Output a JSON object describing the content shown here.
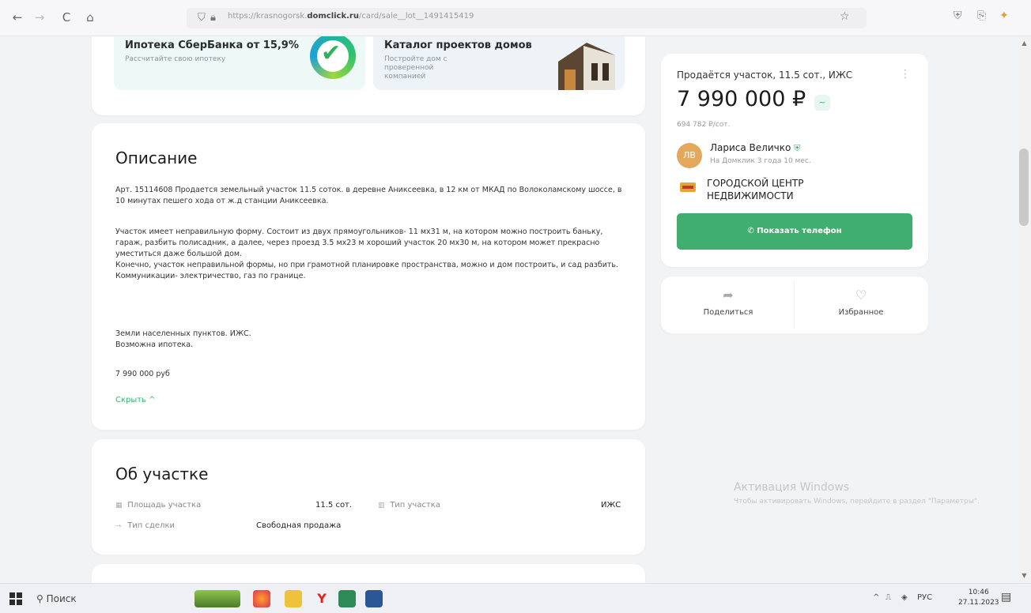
{
  "browser": {
    "back": "←",
    "forward": "→",
    "reload": "C",
    "home": "⌂",
    "url_prefix": "https://krasnogorsk.",
    "url_domain": "domclick.ru",
    "url_suffix": "/card/sale__lot__1491415419",
    "star": "☆"
  },
  "promos": [
    {
      "title": "Ипотека СберБанка от 15,9%",
      "subtitle": "Рассчитайте свою ипотеку"
    },
    {
      "title": "Каталог проектов домов",
      "subtitle": "Постройте дом с проверенной компанией"
    }
  ],
  "description": {
    "title": "Описание",
    "paragraphs": [
      "Арт. 15114608 Продается земельный участок 11.5 соток. в деревне Аниксеевка, в 12 км от МКАД по Волоколамскому шоссе, в 10 минутах пешего хода от ж.д станции Аниксеевка.",
      "Участок имеет неправильную форму. Состоит из двух прямоугольников- 11 мх31 м, на котором можно построить баньку, гараж, разбить полисадник, а далее, через проезд 3.5 мх23 м хороший участок 20 мх30 м, на котором может прекрасно уместиться даже большой дом.\nКонечно, участок неправильной формы, но при грамотной планировке пространства, можно и дом построить, и сад разбить.\nКоммуникации- электричество, газ по границе.",
      "Земли населенных пунктов. ИЖС.\nВозможна ипотека.",
      "7 990 000 руб"
    ],
    "hide_label": "Скрыть ^"
  },
  "plot": {
    "title": "Об участке",
    "area_label": "Площадь участка",
    "area_value": "11.5 сот.",
    "type_label": "Тип участка",
    "type_value": "ИЖС",
    "deal_label": "Тип сделки",
    "deal_value": "Свободная продажа"
  },
  "offer": {
    "title": "Продаётся участок, 11.5 сот., ИЖС",
    "price": "7 990 000 ₽",
    "trend_icon": "~",
    "per_unit": "694 782 ₽/сот.",
    "seller_initials": "ЛВ",
    "seller_name": "Лариса Величко",
    "seller_sub": "На Домклик 3 года 10 мес.",
    "agency_name": "ГОРОДСКОЙ ЦЕНТР НЕДВИЖИМОСТИ",
    "phone_button": "Показать телефон",
    "accent_color": "#3fae6e"
  },
  "actions": {
    "share": "Поделиться",
    "favorite": "Избранное"
  },
  "watermark": {
    "title": "Активация Windows",
    "subtitle": "Чтобы активировать Windows, перейдите в раздел \"Параметры\"."
  },
  "taskbar": {
    "search": "Поиск",
    "lang": "РУС",
    "time": "10:46",
    "date": "27.11.2023"
  }
}
